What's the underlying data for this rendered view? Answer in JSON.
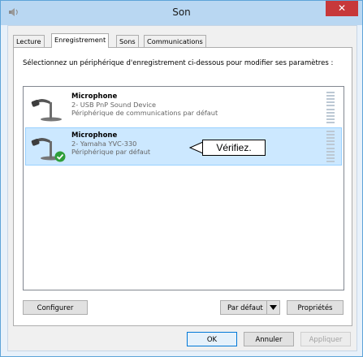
{
  "window": {
    "title": "Son",
    "close_glyph": "✕"
  },
  "tabs": [
    {
      "label": "Lecture",
      "active": false
    },
    {
      "label": "Enregistrement",
      "active": true
    },
    {
      "label": "Sons",
      "active": false
    },
    {
      "label": "Communications",
      "active": false
    }
  ],
  "instructions": "Sélectionnez un périphérique d'enregistrement ci-dessous pour modifier ses paramètres :",
  "devices": [
    {
      "name": "Microphone",
      "model": "2- USB PnP Sound Device",
      "status": "Périphérique de communications par défaut",
      "selected": false,
      "default_check": false,
      "icon": "microphone-icon"
    },
    {
      "name": "Microphone",
      "model": "2- Yamaha YVC-330",
      "status": "Périphérique par défaut",
      "selected": true,
      "default_check": true,
      "icon": "microphone-icon"
    }
  ],
  "callout": {
    "text": "Vérifiez."
  },
  "buttons": {
    "configure": "Configurer",
    "set_default": "Par défaut",
    "properties": "Propriétés",
    "ok": "OK",
    "cancel": "Annuler",
    "apply": "Appliquer"
  },
  "colors": {
    "selection": "#cce8ff",
    "title_bar": "#b9d7f2",
    "close": "#c7383a",
    "check": "#2e9e3a"
  }
}
